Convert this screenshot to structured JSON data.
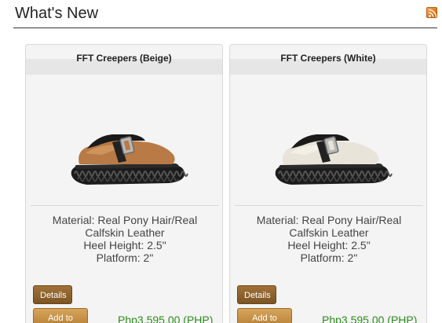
{
  "section": {
    "title": "What's New",
    "icon": "rss-feed-icon"
  },
  "products": [
    {
      "name": "FFT Creepers (Beige)",
      "desc": [
        "Material: Real Pony Hair/Real",
        "Calfskin Leather",
        "Heel Height: 2.5\"",
        "Platform: 2\""
      ],
      "details_label": "Details",
      "cart_label": "Add to cart",
      "price": "Php3,595.00 (PHP)",
      "upper_color": "#b97a45",
      "upper_light": "#d9a06a"
    },
    {
      "name": "FFT Creepers (White)",
      "desc": [
        "Material: Real Pony Hair/Real",
        "Calfskin Leather",
        "Heel Height: 2.5\"",
        "Platform: 2\""
      ],
      "details_label": "Details",
      "cart_label": "Add to cart",
      "price": "Php3,595.00 (PHP)",
      "upper_color": "#e8e4da",
      "upper_light": "#f6f3ec"
    }
  ]
}
